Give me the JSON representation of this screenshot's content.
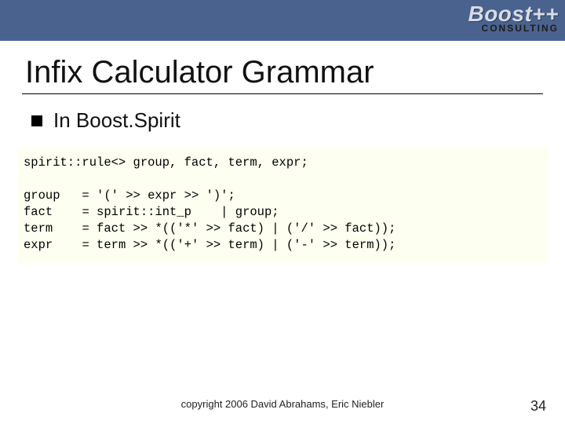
{
  "logo": {
    "main": "Boost++",
    "sub": "CONSULTING"
  },
  "title": "Infix Calculator Grammar",
  "subtitle": "In Boost.Spirit",
  "code": {
    "line_decl": "spirit::rule<> group, fact, term, expr;",
    "rules": [
      {
        "name": "group",
        "rhs": "= '(' >> expr >> ')';"
      },
      {
        "name": "fact",
        "rhs": "= spirit::int_p    | group;"
      },
      {
        "name": "term",
        "rhs": "= fact >> *(('*' >> fact) | ('/' >> fact));"
      },
      {
        "name": "expr",
        "rhs": "= term >> *(('+' >> term) | ('-' >> term));"
      }
    ]
  },
  "footer": {
    "copyright": "copyright 2006 David Abrahams, Eric Niebler",
    "page": "34"
  }
}
